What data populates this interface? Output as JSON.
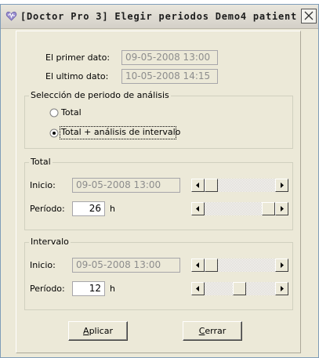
{
  "window": {
    "title": "[Doctor Pro 3] Elegir periodos  Demo4 patient"
  },
  "dates": {
    "first_label": "El primer dato:",
    "first_value": "09-05-2008 13:00",
    "last_label": "El ultimo dato:",
    "last_value": "10-05-2008 14:15"
  },
  "analysis": {
    "group_title": "Selección de periodo de análisis",
    "options": [
      {
        "label": "Total",
        "selected": false
      },
      {
        "label": "Total + análisis de intervalo",
        "selected": true
      }
    ]
  },
  "total": {
    "group_title": "Total",
    "start_label": "Inicio:",
    "start_value": "09-05-2008 13:00",
    "period_label": "Período:",
    "period_value": "26",
    "period_unit": "h"
  },
  "interval": {
    "group_title": "Intervalo",
    "start_label": "Inicio:",
    "start_value": "09-05-2008 13:00",
    "period_label": "Período:",
    "period_value": "12",
    "period_unit": "h"
  },
  "buttons": {
    "apply": "Aplicar",
    "apply_accel": "A",
    "close": "Cerrar",
    "close_accel": "C"
  }
}
